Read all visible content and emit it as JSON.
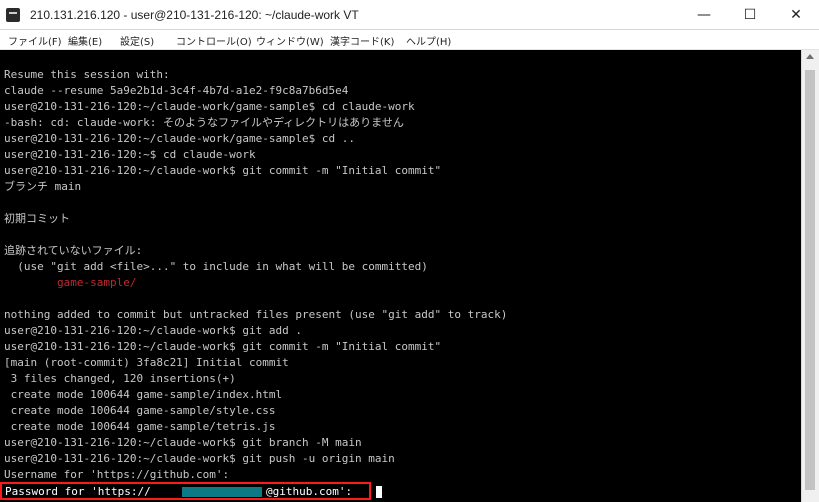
{
  "window": {
    "title": "210.131.216.120 - user@210-131-216-120: ~/claude-work VT",
    "controls": {
      "minimize": "—",
      "maximize": "☐",
      "close": "✕"
    }
  },
  "menubar": {
    "items": [
      "ファイル(F)",
      "編集(E)",
      "設定(S)",
      "コントロール(O)",
      "ウィンドウ(W)",
      "漢字コード(K)",
      "ヘルプ(H)"
    ]
  },
  "terminal": {
    "lines": [
      {
        "text": "Resume this session with:",
        "color": "gray"
      },
      {
        "text": "claude --resume 5a9e2b1d-3c4f-4b7d-a1e2-f9c8a7b6d5e4",
        "color": "gray"
      },
      {
        "text": "user@210-131-216-120:~/claude-work/game-sample$ cd claude-work",
        "color": "gray"
      },
      {
        "text": "-bash: cd: claude-work: そのようなファイルやディレクトリはありません",
        "color": "gray"
      },
      {
        "text": "user@210-131-216-120:~/claude-work/game-sample$ cd ..",
        "color": "gray"
      },
      {
        "text": "user@210-131-216-120:~$ cd claude-work",
        "color": "gray"
      },
      {
        "text": "user@210-131-216-120:~/claude-work$ git commit -m \"Initial commit\"",
        "color": "gray"
      },
      {
        "text": "ブランチ main",
        "color": "gray"
      },
      {
        "text": "",
        "color": "gray"
      },
      {
        "text": "初期コミット",
        "color": "gray"
      },
      {
        "text": "",
        "color": "gray"
      },
      {
        "text": "追跡されていないファイル:",
        "color": "gray"
      },
      {
        "text": "  (use \"git add <file>...\" to include in what will be committed)",
        "color": "gray"
      },
      {
        "text": "        game-sample/",
        "color": "red"
      },
      {
        "text": "",
        "color": "gray"
      },
      {
        "text": "nothing added to commit but untracked files present (use \"git add\" to track)",
        "color": "gray"
      },
      {
        "text": "user@210-131-216-120:~/claude-work$ git add .",
        "color": "gray"
      },
      {
        "text": "user@210-131-216-120:~/claude-work$ git commit -m \"Initial commit\"",
        "color": "gray"
      },
      {
        "text": "[main (root-commit) 3fa8c21] Initial commit",
        "color": "gray"
      },
      {
        "text": " 3 files changed, 120 insertions(+)",
        "color": "gray"
      },
      {
        "text": " create mode 100644 game-sample/index.html",
        "color": "gray"
      },
      {
        "text": " create mode 100644 game-sample/style.css",
        "color": "gray"
      },
      {
        "text": " create mode 100644 game-sample/tetris.js",
        "color": "gray"
      },
      {
        "text": "user@210-131-216-120:~/claude-work$ git branch -M main",
        "color": "gray"
      },
      {
        "text": "user@210-131-216-120:~/claude-work$ git push -u origin main",
        "color": "gray"
      },
      {
        "text": "Username for 'https://github.com': ",
        "color": "gray"
      }
    ],
    "password_prompt": {
      "prefix": "Password for 'https://",
      "suffix": "@github.com':"
    }
  }
}
